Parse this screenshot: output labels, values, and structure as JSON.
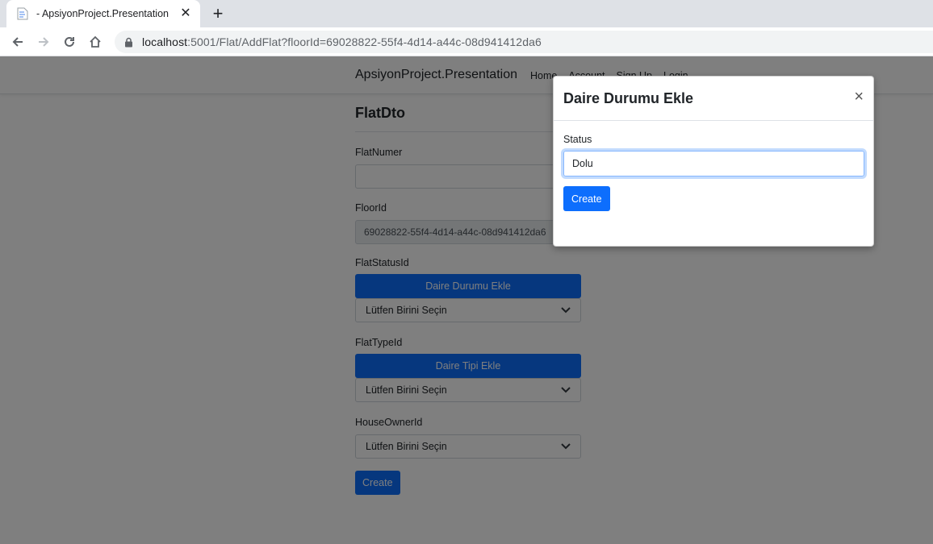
{
  "browser": {
    "tab_title": "- ApsiyonProject.Presentation",
    "url_host": "localhost",
    "url_rest": ":5001/Flat/AddFlat?floorId=69028822-55f4-4d14-a44c-08d941412da6"
  },
  "site": {
    "brand": "ApsiyonProject.Presentation",
    "nav": [
      "Home",
      "Account",
      "Sign Up",
      "Login"
    ]
  },
  "form": {
    "heading": "FlatDto",
    "flat_numer_label": "FlatNumer",
    "flat_numer_value": "",
    "floor_id_label": "FloorId",
    "floor_id_value": "69028822-55f4-4d14-a44c-08d941412da6",
    "flat_status_label": "FlatStatusId",
    "add_status_button": "Daire Durumu Ekle",
    "flat_status_select": "Lütfen Birini Seçin",
    "flat_type_label": "FlatTypeId",
    "add_type_button": "Daire Tipi Ekle",
    "flat_type_select": "Lütfen Birini Seçin",
    "house_owner_label": "HouseOwnerId",
    "house_owner_select": "Lütfen Birini Seçin",
    "create_button": "Create"
  },
  "modal": {
    "title": "Daire Durumu Ekle",
    "close": "×",
    "status_label": "Status",
    "status_value": "Dolu",
    "create_button": "Create"
  },
  "colors": {
    "primary": "#0d6efd",
    "backdrop": "rgba(0,0,0,0.5)"
  }
}
